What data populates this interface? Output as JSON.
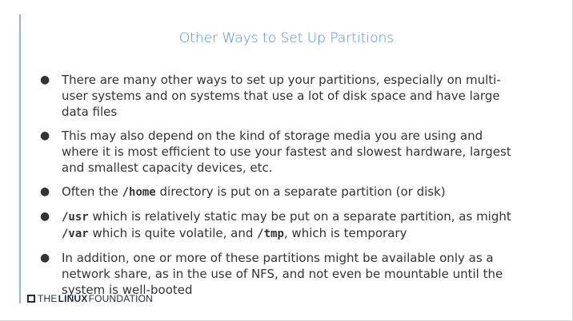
{
  "slide": {
    "title": "Other Ways to Set Up Partitions",
    "bullets": [
      {
        "text": "There are many other ways to set up your partitions, especially on multi-user systems and on systems that use a lot of disk space and have large data files"
      },
      {
        "text": "This may also depend on the kind of storage media you are using and where it is most efficient to use your fastest and slowest hardware, largest and smallest capacity devices, etc."
      },
      {
        "pre": "Often the ",
        "code1": "/home",
        "post": " directory is put on a separate partition (or disk)"
      },
      {
        "code1": "/usr",
        "mid1": " which is relatively static may be put on a separate partition, as might ",
        "code2": "/var",
        "mid2": " which is quite volatile, and ",
        "code3": "/tmp",
        "post": ", which is temporary"
      },
      {
        "text": "In addition, one or more of these partitions might be available only as a network share, as in the use of NFS, and not even be mountable until the system is well-booted"
      }
    ],
    "bullet_symbol": "●"
  },
  "footer": {
    "logo_part1": "THE",
    "logo_part2": "LINUX",
    "logo_part3": "FOUNDATION"
  },
  "colors": {
    "title": "#4a90e2",
    "accent_rule": "#8fb8de",
    "text": "#333333",
    "logo": "#1f2d3d"
  }
}
